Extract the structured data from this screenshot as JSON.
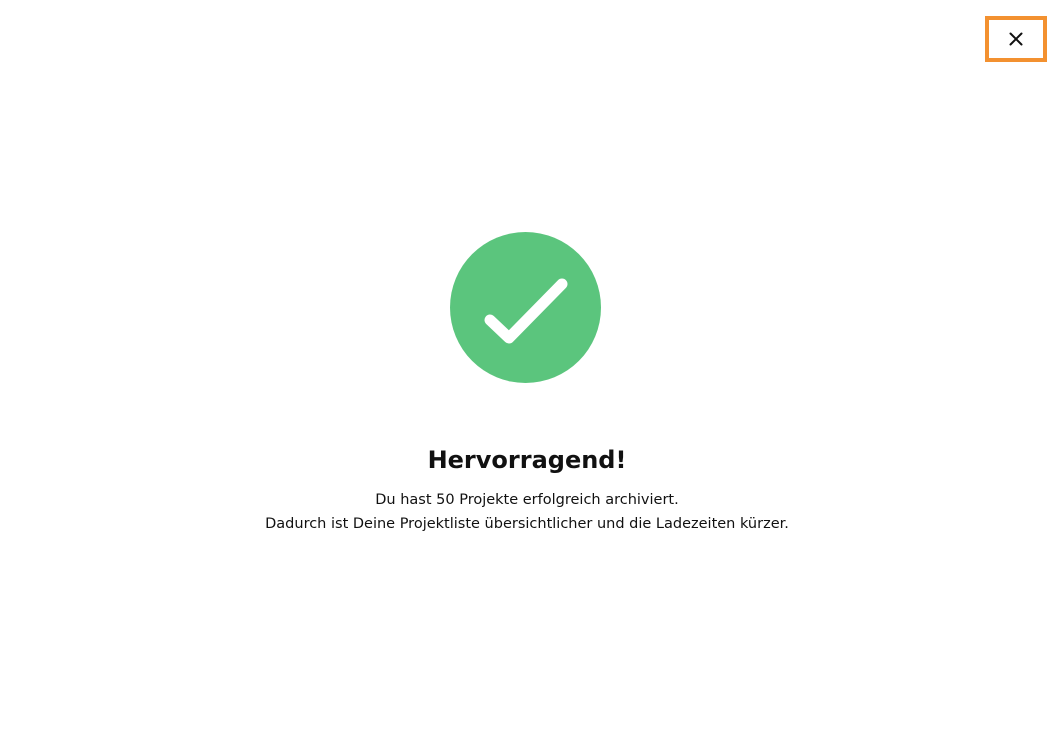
{
  "close_button": {
    "icon": "close-icon",
    "highlight_color": "#F39130"
  },
  "success": {
    "icon": "checkmark-icon",
    "color": "#5BC57D"
  },
  "title": "Hervorragend!",
  "message": {
    "line1": "Du hast 50 Projekte erfolgreich archiviert.",
    "line2": "Dadurch ist Deine Projektliste übersichtlicher und die Ladezeiten kürzer."
  }
}
